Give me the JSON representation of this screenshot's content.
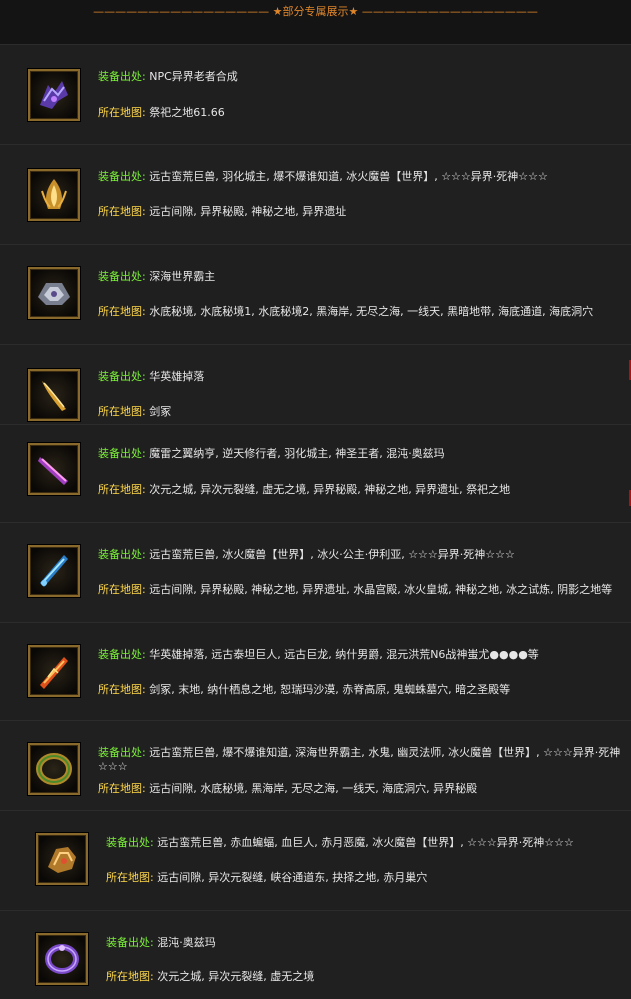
{
  "header": {
    "title": "———————————————— ★部分专属展示★ ————————————————"
  },
  "labels": {
    "source": "装备出处:",
    "map": "所在地图:"
  },
  "items": [
    {
      "icon": "purple-wing-armor-icon",
      "source": "NPC异界老者合成",
      "map": "祭祀之地61.66"
    },
    {
      "icon": "golden-flame-helmet-icon",
      "source": "远古蛮荒巨兽, 羽化城主, 爆不爆谁知道, 冰火魔兽【世界】, ☆☆☆异界·死神☆☆☆",
      "map": "远古间隙, 异界秘殿, 神秘之地, 异界遗址"
    },
    {
      "icon": "silver-armor-icon",
      "source": "深海世界霸主",
      "map": "水底秘境, 水底秘境1, 水底秘境2, 黑海岸, 无尽之海, 一线天, 黑暗地带, 海底通道, 海底洞穴"
    },
    {
      "icon": "golden-sword-icon",
      "source": "华英雄掉落",
      "map": "剑冢"
    },
    {
      "icon": "purple-blade-icon",
      "source": "魔雷之翼纳亨, 逆天修行者, 羽化城主, 神圣王者, 混沌·奥兹玛",
      "map": "次元之城, 异次元裂缝, 虚无之境, 异界秘殿, 神秘之地, 异界遗址, 祭祀之地"
    },
    {
      "icon": "ice-blade-icon",
      "source": "远古蛮荒巨兽, 冰火魔兽【世界】, 冰火·公主·伊利亚, ☆☆☆异界·死神☆☆☆",
      "map": "远古间隙, 异界秘殿, 神秘之地, 异界遗址, 水晶宫殿, 冰火皇城, 神秘之地, 冰之试炼, 阴影之地等"
    },
    {
      "icon": "fire-sword-icon",
      "source": "华英雄掉落, 远古泰坦巨人, 远古巨龙, 纳什男爵, 混元洪荒N6战神蚩尤●●●●等",
      "map": "剑冢, 末地, 纳什栖息之地, 恕瑞玛沙漠, 赤脊高原, 鬼蜘蛛墓穴, 暗之圣殿等"
    },
    {
      "icon": "green-ring-icon",
      "source": "远古蛮荒巨兽, 爆不爆谁知道, 深海世界霸主, 水鬼, 幽灵法师, 冰火魔兽【世界】, ☆☆☆异界·死神☆☆☆",
      "map": "远古间隙, 水底秘境, 黑海岸, 无尽之海, 一线天, 海底洞穴, 异界秘殿"
    },
    {
      "icon": "dragon-helmet-icon",
      "source": "远古蛮荒巨兽, 赤血蝙蝠, 血巨人, 赤月恶魔, 冰火魔兽【世界】, ☆☆☆异界·死神☆☆☆",
      "map": "远古间隙, 异次元裂缝, 峡谷通道东, 抉择之地, 赤月巢穴"
    },
    {
      "icon": "purple-ring-icon",
      "source": "混沌·奥兹玛",
      "map": "次元之城, 异次元裂缝, 虚无之境"
    }
  ]
}
